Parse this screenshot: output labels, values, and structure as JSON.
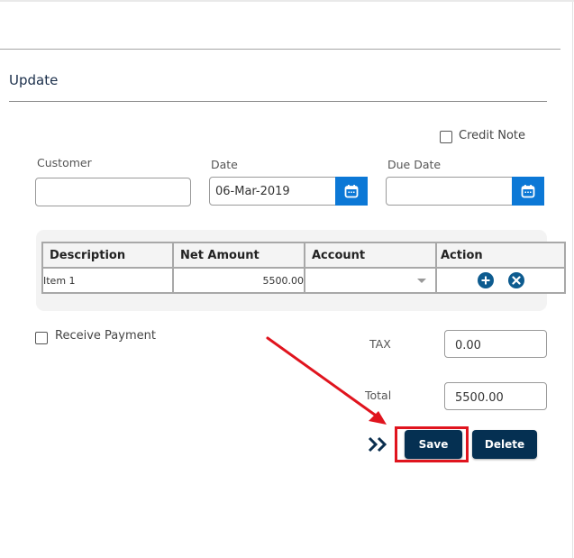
{
  "page": {
    "title": "Update"
  },
  "form": {
    "credit_note": {
      "label": "Credit Note",
      "checked": false
    },
    "customer": {
      "label": "Customer",
      "value": ""
    },
    "date": {
      "label": "Date",
      "value": "06-Mar-2019",
      "icon": "calendar-icon"
    },
    "due_date": {
      "label": "Due Date",
      "value": "",
      "icon": "calendar-icon"
    },
    "receive_payment": {
      "label": "Receive Payment",
      "checked": false
    },
    "tax": {
      "label": "TAX",
      "value": "0.00"
    },
    "total": {
      "label": "Total",
      "value": "5500.00"
    }
  },
  "grid": {
    "columns": [
      "Description",
      "Net Amount",
      "Account",
      "Action"
    ],
    "rows": [
      {
        "description": "Item 1",
        "net_amount": "5500.00",
        "account": "",
        "actions": [
          "plus-circle-icon",
          "close-circle-icon"
        ]
      }
    ]
  },
  "actions": {
    "save_label": "Save",
    "delete_label": "Delete",
    "chevron_icon": "double-chevron-right-icon"
  },
  "annotation": {
    "highlight_color": "#e0141e",
    "target": "Save"
  },
  "colors": {
    "primary_button": "#053052",
    "calendar_button": "#0c78d6",
    "action_icon": "#0d5b8f",
    "title_text": "#1a2e4a"
  }
}
